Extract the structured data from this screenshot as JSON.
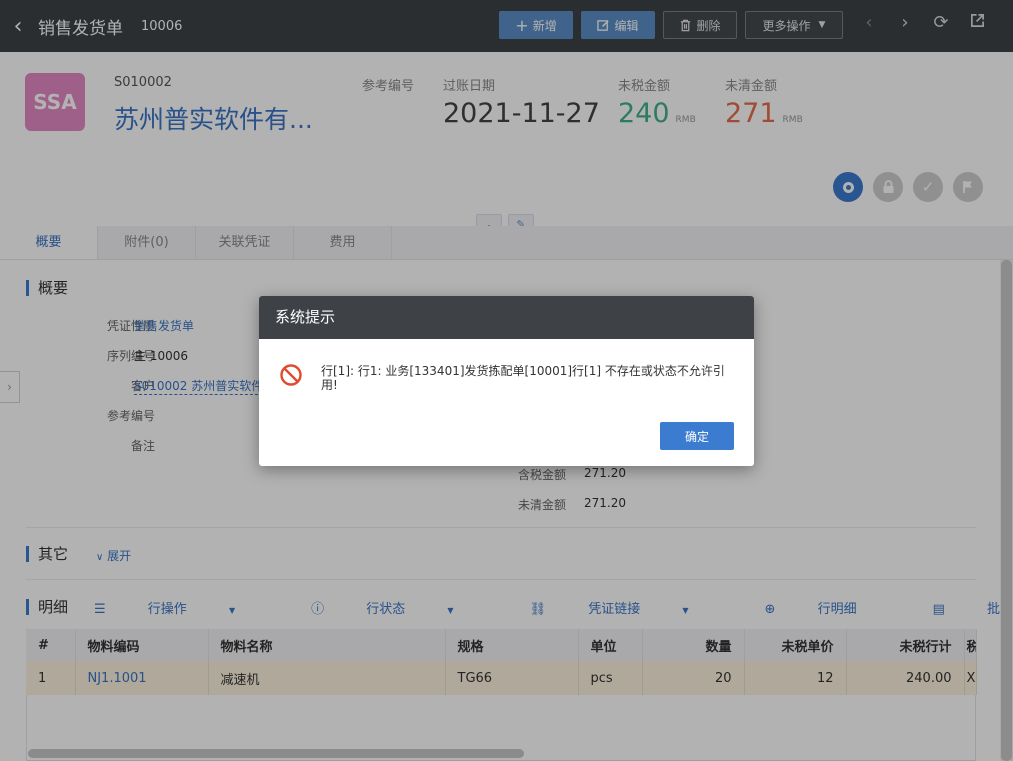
{
  "topbar": {
    "title": "销售发货单",
    "doc_no": "10006",
    "buttons": {
      "new": "新增",
      "edit": "编辑",
      "delete": "删除",
      "more": "更多操作"
    }
  },
  "header": {
    "avatar_text": "SSA",
    "customer_code": "S010002",
    "customer_name": "苏州普实软件有...",
    "ref_no_label": "参考编号",
    "post_date_label": "过账日期",
    "post_date": "2021-11-27",
    "untaxed_label": "未税金额",
    "untaxed_value": "240",
    "uncleared_label": "未清金额",
    "uncleared_value": "271",
    "currency": "RMB",
    "colors": {
      "untaxed": "#43b28a",
      "uncleared": "#e46c4c",
      "accent": "#3b7bd0"
    }
  },
  "tabs": [
    {
      "label": "概要"
    },
    {
      "label": "附件(0)"
    },
    {
      "label": "关联凭证"
    },
    {
      "label": "费用"
    }
  ],
  "summary": {
    "title": "概要",
    "fields": [
      {
        "label": "凭证性质",
        "value": "销售发货单"
      },
      {
        "label": "序列编号",
        "value": "主 10006"
      },
      {
        "label": "客户",
        "value": "S010002 苏州普实软件"
      },
      {
        "label": "参考编号",
        "value": ""
      },
      {
        "label": "备注",
        "value": ""
      }
    ],
    "right_fields": [
      {
        "label": "含税金额",
        "value": "271.20"
      },
      {
        "label": "未清金额",
        "value": "271.20"
      }
    ]
  },
  "other": {
    "title": "其它",
    "expand": "展开"
  },
  "detail": {
    "title": "明细",
    "toolbar": {
      "row_ops": "行操作",
      "row_status": "行状态",
      "doc_link": "凭证链接",
      "row_detail": "行明细",
      "batch": "批次"
    },
    "columns": [
      "#",
      "物料编码",
      "物料名称",
      "规格",
      "单位",
      "数量",
      "未税单价",
      "未税行计",
      "税"
    ],
    "rows": [
      [
        "1",
        "NJ1.1001",
        "减速机",
        "TG66",
        "pcs",
        "20",
        "12",
        "240.00",
        "X"
      ]
    ]
  },
  "dialog": {
    "title": "系统提示",
    "message": "行[1]: 行1: 业务[133401]发货拣配单[10001]行[1] 不存在或状态不允许引用!",
    "ok": "确定"
  }
}
